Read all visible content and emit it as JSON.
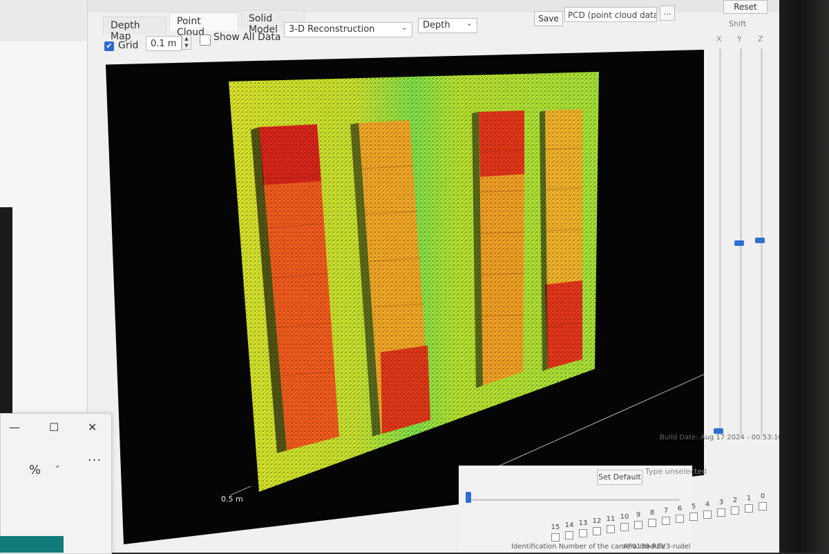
{
  "app": {
    "tabs": [
      {
        "label": "Depth Map",
        "active": false
      },
      {
        "label": "Point Cloud",
        "active": true
      },
      {
        "label": "Solid Model",
        "active": false
      }
    ],
    "save_label": "Save",
    "format_value": "PCD (point cloud data…",
    "browse_label": "...",
    "reset_label": "Reset",
    "grid": {
      "label": "Grid",
      "checked": true,
      "size_value": "0.1 m"
    },
    "show_all": {
      "label": "Show All Data",
      "checked": false
    },
    "view_mode_value": "3-D Reconstruction",
    "color_mode_value": "Depth",
    "scale_label": "0.5 m",
    "shift": {
      "label": "Shift",
      "axes": [
        "X",
        "Y",
        "Z"
      ]
    },
    "build_date": "Build Date: Aug 17 2024 - 00:53:10",
    "set_default_label": "Set Default",
    "type_label": "Type unselected",
    "bit_numbers": [
      "15",
      "14",
      "13",
      "12",
      "11",
      "10",
      "9",
      "8",
      "7",
      "6",
      "5",
      "4",
      "3",
      "2",
      "1",
      "0"
    ],
    "module_note": "Identification Number of the camera module",
    "module_id": "AF0139-REV3-rudel"
  },
  "mini_window": {
    "minimize": "—",
    "maximize": "☐",
    "close": "✕",
    "ratio_icon": "%",
    "more": "···"
  },
  "viewport": {
    "background": "#050505",
    "depth_colors": [
      "#e02a12",
      "#f05a18",
      "#f49a24",
      "#e8c826",
      "#c8e02c",
      "#8ee43a",
      "#4fe06a"
    ]
  },
  "icons": [
    "checkbox-checked-icon",
    "spinner-icon",
    "chevron-down-icon",
    "slider-thumb-icon"
  ]
}
